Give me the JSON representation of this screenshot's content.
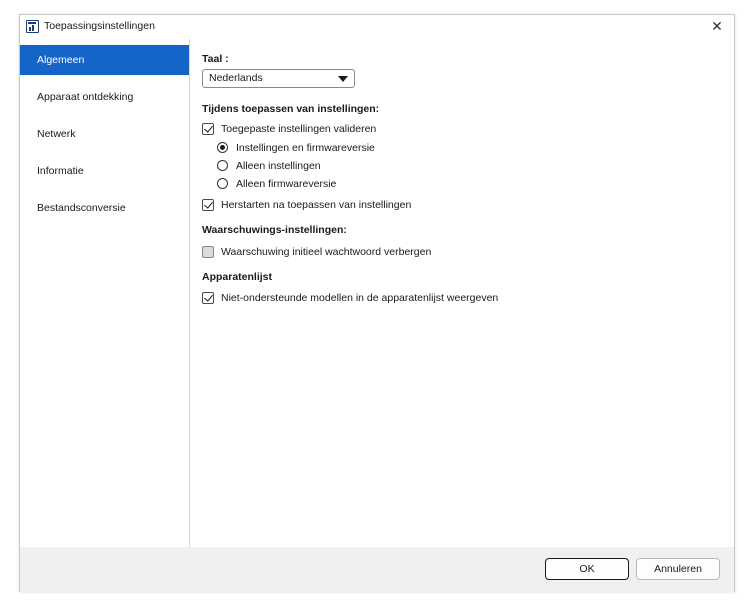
{
  "window": {
    "title": "Toepassingsinstellingen",
    "close_glyph": "✕"
  },
  "sidebar": {
    "items": [
      {
        "label": "Algemeen",
        "active": true
      },
      {
        "label": "Apparaat ontdekking",
        "active": false
      },
      {
        "label": "Netwerk",
        "active": false
      },
      {
        "label": "Informatie",
        "active": false
      },
      {
        "label": "Bestandsconversie",
        "active": false
      }
    ]
  },
  "general": {
    "language_label": "Taal :",
    "language_value": "Nederlands",
    "apply_heading": "Tijdens toepassen van instellingen:",
    "validate_label": "Toegepaste instellingen valideren",
    "validate_checked": true,
    "radio_options": [
      {
        "label": "Instellingen en firmwareversie",
        "selected": true
      },
      {
        "label": "Alleen instellingen",
        "selected": false
      },
      {
        "label": "Alleen firmwareversie",
        "selected": false
      }
    ],
    "restart_label": "Herstarten na toepassen van instellingen",
    "restart_checked": true,
    "warning_heading": "Waarschuwings-instellingen:",
    "hide_password_warning_label": "Waarschuwing initieel wachtwoord verbergen",
    "hide_password_warning_checked": false,
    "devicelist_heading": "Apparatenlijst",
    "show_unsupported_label": "Niet-ondersteunde modellen in de apparatenlijst weergeven",
    "show_unsupported_checked": true
  },
  "footer": {
    "ok_label": "OK",
    "cancel_label": "Annuleren"
  },
  "colors": {
    "accent": "#1565c8",
    "footer_bg": "#f0f0f0"
  }
}
